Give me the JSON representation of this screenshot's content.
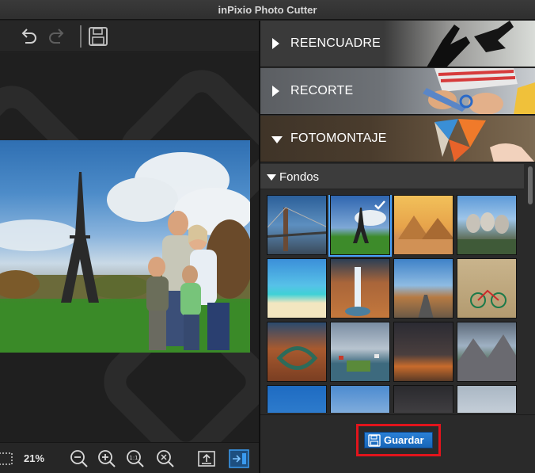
{
  "window": {
    "title": "inPixio Photo Cutter"
  },
  "toolbar": {
    "undo_icon": "undo-icon",
    "redo_icon": "redo-icon",
    "save_icon": "floppy-disk-icon"
  },
  "statusbar": {
    "zoom_level": "21%",
    "icons": [
      "fit-screen-icon",
      "zoom-out-icon",
      "zoom-in-icon",
      "zoom-actual-size-icon",
      "zoom-fit-icon",
      "export-icon",
      "toggle-panel-icon"
    ]
  },
  "panel": {
    "sections": [
      {
        "label": "REENCUADRE",
        "expanded": false
      },
      {
        "label": "RECORTE",
        "expanded": false
      },
      {
        "label": "FOTOMONTAJE",
        "expanded": true
      }
    ],
    "fondos": {
      "label": "Fondos",
      "selected_index": 1,
      "thumbnails": [
        "bridge",
        "eiffel-tower",
        "pyramids",
        "mount-rushmore",
        "tropical-beach",
        "waterfall-canyon",
        "desert-road",
        "bicycle-wall",
        "horseshoe-bend",
        "coastal-village",
        "desert-storm",
        "mountain-valley",
        "blue-sky",
        "sky-clouds",
        "dark-sky",
        "winter-sky"
      ]
    },
    "save_label": "Guardar"
  },
  "colors": {
    "accent": "#1f74c8",
    "highlight": "#e2141c",
    "selected": "#4aa3ff"
  }
}
